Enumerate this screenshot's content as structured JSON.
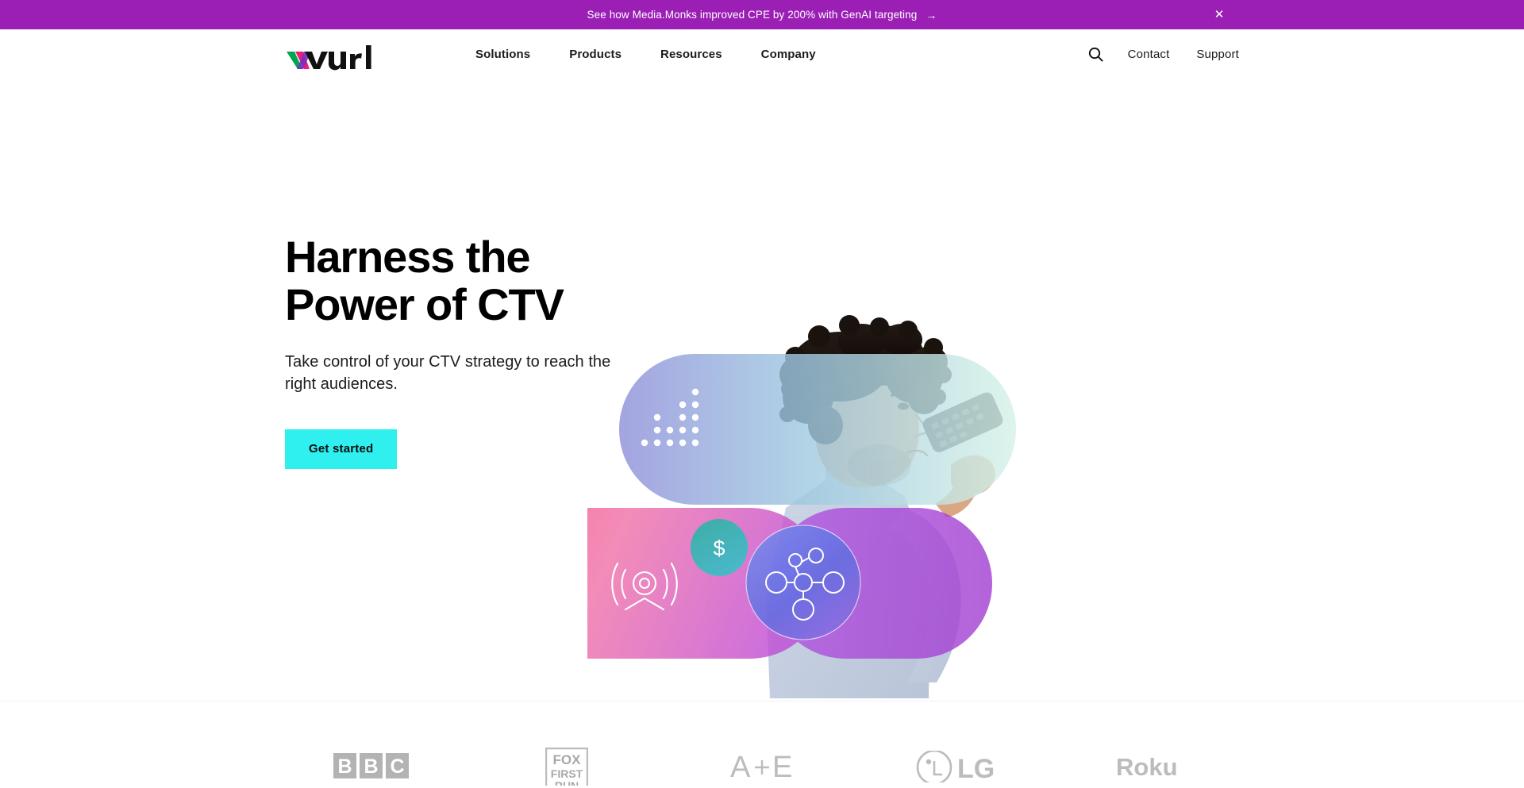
{
  "banner": {
    "message": "See how Media.Monks improved CPE by 200% with GenAI targeting",
    "arrow": "→",
    "close_label": "✕",
    "close_icon_name": "close-icon",
    "background_color": "#9B1FB5",
    "text_color": "#ffffff"
  },
  "header": {
    "logo_text": "wurl",
    "logo_colors": {
      "green": "#00A651",
      "magenta": "#EC1E79",
      "purple": "#7B2FBE",
      "black": "#111111"
    },
    "nav": [
      {
        "label": "Solutions"
      },
      {
        "label": "Products"
      },
      {
        "label": "Resources"
      },
      {
        "label": "Company"
      }
    ],
    "search_icon_name": "search-icon",
    "utility": [
      {
        "label": "Contact"
      },
      {
        "label": "Support"
      }
    ]
  },
  "hero": {
    "title_line1": "Harness the",
    "title_line2": "Power of CTV",
    "subtitle": "Take control of your CTV strategy to reach the right audiences.",
    "cta_label": "Get started",
    "cta_color": "#2FEFEF",
    "artwork": {
      "description": "Man with curly hair holding a TV remote behind overlapping translucent gradient shapes",
      "icons": [
        {
          "name": "bar-dots-icon"
        },
        {
          "name": "broadcast-signal-icon"
        },
        {
          "name": "dollar-icon",
          "glyph": "$"
        },
        {
          "name": "network-nodes-icon"
        }
      ],
      "colors": {
        "pill_top_left": "#8E8ED8",
        "pill_top_right": "#D7F2E6",
        "circle_pink": "#F9468A",
        "circle_teal": "#17A89A",
        "circle_blue": "#5B6FE0",
        "circle_purple": "#A63DD6"
      }
    }
  },
  "logos": [
    {
      "name": "bbc-logo",
      "label": "BBC"
    },
    {
      "name": "fox-first-run-logo",
      "label": "FOX FIRST RUN"
    },
    {
      "name": "ae-logo",
      "label": "A+E"
    },
    {
      "name": "lg-logo",
      "label": "LG"
    },
    {
      "name": "roku-logo",
      "label": "Roku"
    }
  ]
}
